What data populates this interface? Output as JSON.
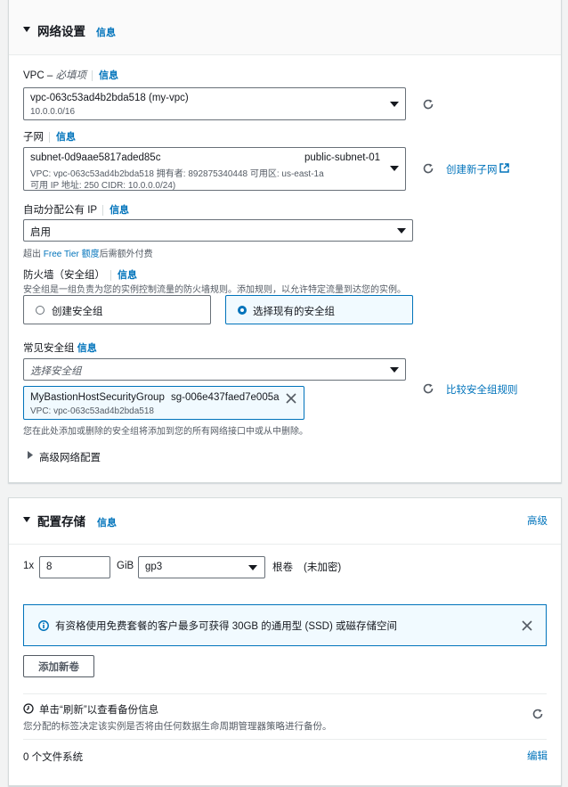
{
  "network": {
    "title": "网络设置",
    "info": "信息",
    "vpc": {
      "label": "VPC",
      "dash": " – ",
      "required": "必填项",
      "info": "信息",
      "value": "vpc-063c53ad4b2bda518 (my-vpc)",
      "cidr": "10.0.0.0/16"
    },
    "subnet": {
      "label": "子网",
      "info": "信息",
      "id": "subnet-0d9aae5817aded85c",
      "name": "public-subnet-01",
      "detail_line1": "VPC: vpc-063c53ad4b2bda518     拥有者: 892875340448     可用区: us-east-1a",
      "detail_line2": "可用 IP 地址: 250     CIDR: 10.0.0.0/24)",
      "create_link": "创建新子网"
    },
    "public_ip": {
      "label": "自动分配公有 IP",
      "info": "信息",
      "value": "启用",
      "note_prefix": "超出 ",
      "note_link": "Free Tier 额度",
      "note_suffix": "后需额外付费"
    },
    "firewall": {
      "label": "防火墙（安全组）",
      "info": "信息",
      "description": "安全组是一组负责为您的实例控制流量的防火墙规则。添加规则，以允许特定流量到达您的实例。",
      "option_create": "创建安全组",
      "option_select": "选择现有的安全组"
    },
    "common_sg": {
      "label": "常见安全组",
      "info": "信息",
      "placeholder": "选择安全组",
      "token_name": "MyBastionHostSecurityGroup",
      "token_id": "sg-006e437faed7e005a",
      "token_vpc": "VPC: vpc-063c53ad4b2bda518",
      "compare_link": "比较安全组规则",
      "note": "您在此处添加或删除的安全组将添加到您的所有网络接口中或从中删除。"
    },
    "advanced": "高级网络配置"
  },
  "storage": {
    "title": "配置存储",
    "info": "信息",
    "advanced_link": "高级",
    "count_prefix": "1x",
    "size_value": "8",
    "unit": "GiB",
    "volume_type": "gp3",
    "root_label": "根卷",
    "encryption": "(未加密)",
    "alert_text": "有资格使用免费套餐的客户最多可获得 30GB 的通用型 (SSD) 或磁存储空间",
    "add_volume_button": "添加新卷",
    "backup_title": "单击“刷新”以查看备份信息",
    "backup_desc": "您分配的标签决定该实例是否将由任何数据生命周期管理器策略进行备份。",
    "filesystems": "0 个文件系统",
    "edit_link": "编辑"
  },
  "colors": {
    "link": "#0073bb",
    "text": "#16191f",
    "muted": "#545b64",
    "border": "#687078",
    "selected_bg": "#f1faff"
  },
  "icons": [
    "caret-down-icon",
    "refresh-icon",
    "external-link-icon",
    "caret-right-icon",
    "close-icon",
    "info-circle-icon",
    "clock-icon"
  ]
}
